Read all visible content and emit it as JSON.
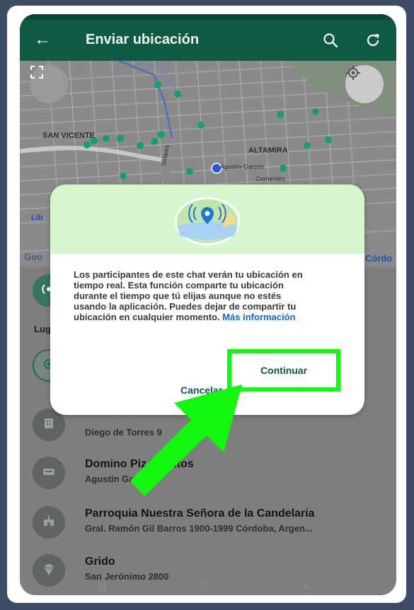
{
  "app_bar": {
    "title": "Enviar ubicación",
    "back_icon": "arrow-left-icon",
    "search_icon": "search-icon",
    "refresh_icon": "refresh-icon"
  },
  "map": {
    "labels": {
      "san_vicente": "SAN VICENTE",
      "altamira": "ALTAMIRA",
      "agustin_garzon": "Agustín Garzón",
      "corrientes": "Corrientes",
      "solares": "Solares",
      "lib": "Lib",
      "cordoba": "Córdo",
      "google": "Goo"
    }
  },
  "list": {
    "section_label": "Lug",
    "items": [
      {
        "title": "",
        "subtitle": "Diego de Torres 9",
        "icon": "building-icon"
      },
      {
        "title": "Domino Piz      Lomitos",
        "subtitle": "Agustín Ga      842",
        "icon": "food-icon"
      },
      {
        "title": "Parroquia Nuestra Señora de la Candelaria",
        "subtitle": "Gral. Ramón Gil Barros 1900-1999 Córdoba, Argen...",
        "icon": "church-icon"
      },
      {
        "title": "Grido",
        "subtitle": "San Jerónimo 2800",
        "icon": "ice-cream-icon"
      }
    ]
  },
  "dialog": {
    "body": "Los participantes de este chat verán tu ubicación en tiempo real. Esta función comparte tu ubicación durante el tiempo que tú elijas aunque no estés usando la aplicación. Puedes dejar de compartir tu ubicación en cualquier momento.",
    "more_link": "Más información",
    "cancel_label": "Cancelar",
    "continue_label": "Continuar"
  },
  "colors": {
    "app_bar": "#0e5a44",
    "dialog_head": "#d6f6cd",
    "highlight": "#12f70e",
    "link": "#1166cc"
  }
}
